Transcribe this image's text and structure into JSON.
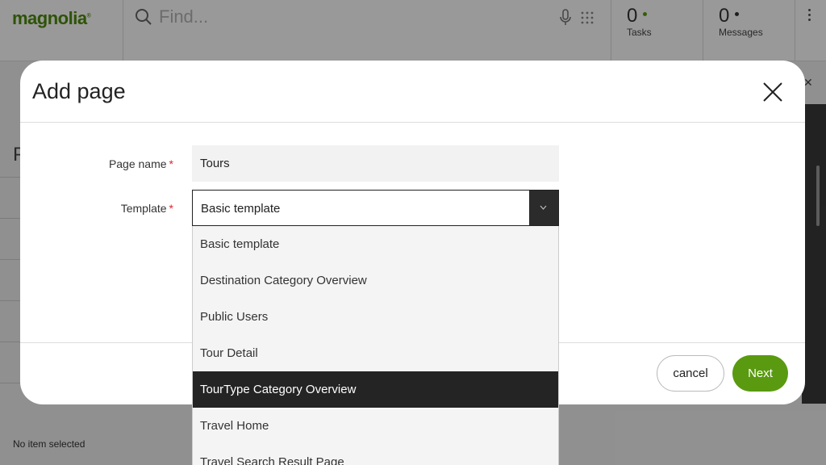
{
  "header": {
    "logo_text": "magnolia",
    "search_placeholder": "Find...",
    "tasks": {
      "count": "0",
      "label": "Tasks",
      "dot_color": "#5a9a10"
    },
    "messages": {
      "count": "0",
      "label": "Messages",
      "dot_color": "#333333"
    }
  },
  "background": {
    "page_title_initial": "P",
    "status": "No item selected"
  },
  "dialog": {
    "title": "Add page",
    "fields": {
      "page_name": {
        "label": "Page name",
        "required_mark": "*",
        "value": "Tours"
      },
      "template": {
        "label": "Template",
        "required_mark": "*",
        "value": "Basic template"
      }
    },
    "buttons": {
      "cancel": "cancel",
      "next": "Next"
    }
  },
  "dropdown": {
    "options": [
      "Basic template",
      "Destination Category Overview",
      "Public Users",
      "Tour Detail",
      "TourType Category Overview",
      "Travel Home",
      "Travel Search Result Page"
    ],
    "highlighted_option": "TourType Category Overview"
  },
  "colors": {
    "brand": "#4e8a0c",
    "primary_button": "#5a9a10",
    "required": "#d9252b",
    "highlight": "#242424"
  }
}
